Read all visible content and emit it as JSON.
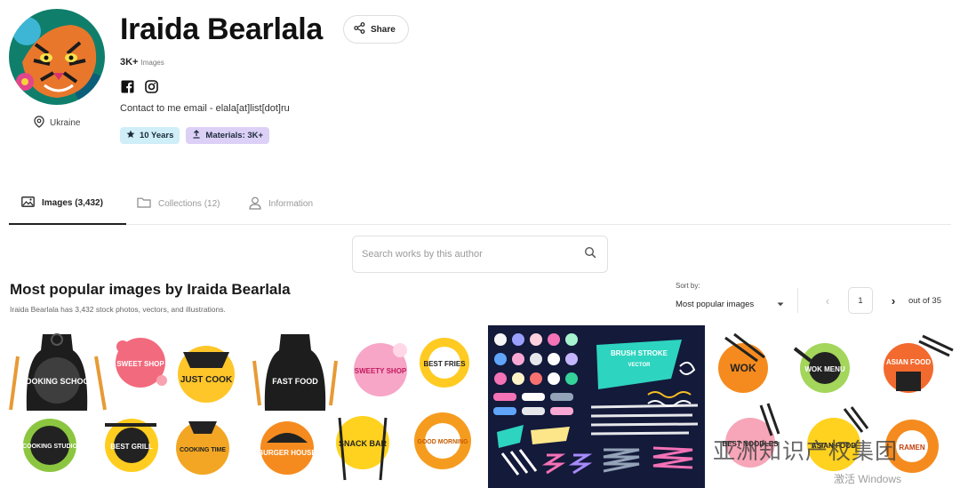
{
  "author": {
    "name": "Iraida Bearlala",
    "location": "Ukraine",
    "images_count": "3K+",
    "images_label": "Images",
    "contact": "Contact to me email - elala[at]list[dot]ru",
    "share_label": "Share",
    "socials": [
      "facebook-icon",
      "instagram-icon"
    ],
    "badges": {
      "years": "10 Years",
      "materials": "Materials: 3K+"
    }
  },
  "tabs": [
    {
      "label": "Images (3,432)",
      "icon": "image-icon",
      "active": true
    },
    {
      "label": "Collections (12)",
      "icon": "folder-icon",
      "active": false
    },
    {
      "label": "Information",
      "icon": "user-icon",
      "active": false
    }
  ],
  "search": {
    "placeholder": "Search works by this author",
    "value": ""
  },
  "section": {
    "title": "Most popular images by Iraida Bearlala",
    "subtitle": "Iraida Bearlala has 3,432 stock photos, vectors, and illustrations."
  },
  "sort": {
    "label": "Sort by:",
    "selected": "Most popular images"
  },
  "pagination": {
    "current": "1",
    "out_of": "out of 35"
  },
  "gallery": [
    {
      "id": "food-logos",
      "labels": [
        "COOKING SCHOOL",
        "SWEET SHOP",
        "JUST COOK",
        "COOKING STUDIO",
        "BEST GRILL",
        "COOKING TIME"
      ]
    },
    {
      "id": "fast-food-logos",
      "labels": [
        "FAST FOOD",
        "SWEETY SHOP",
        "BEST FRIES",
        "BURGER HOUSE",
        "SNACK BAR",
        "GOOD MORNING"
      ]
    },
    {
      "id": "brush-strokes",
      "labels": [
        "BRUSH STROKE",
        "VECTOR"
      ]
    },
    {
      "id": "asian-logos",
      "labels": [
        "WOK",
        "WOK MENU",
        "ASIAN FOOD",
        "BEST NOODLES",
        "ASIAN FOOD",
        "RAMEN"
      ]
    }
  ],
  "overlay": {
    "watermark": "亚洲知识产权集团",
    "os_notice": "激活 Windows"
  },
  "colors": {
    "accent_years": "#cfeef7",
    "accent_materials": "#dcd0f7",
    "brush_bg": "#131a3a"
  }
}
